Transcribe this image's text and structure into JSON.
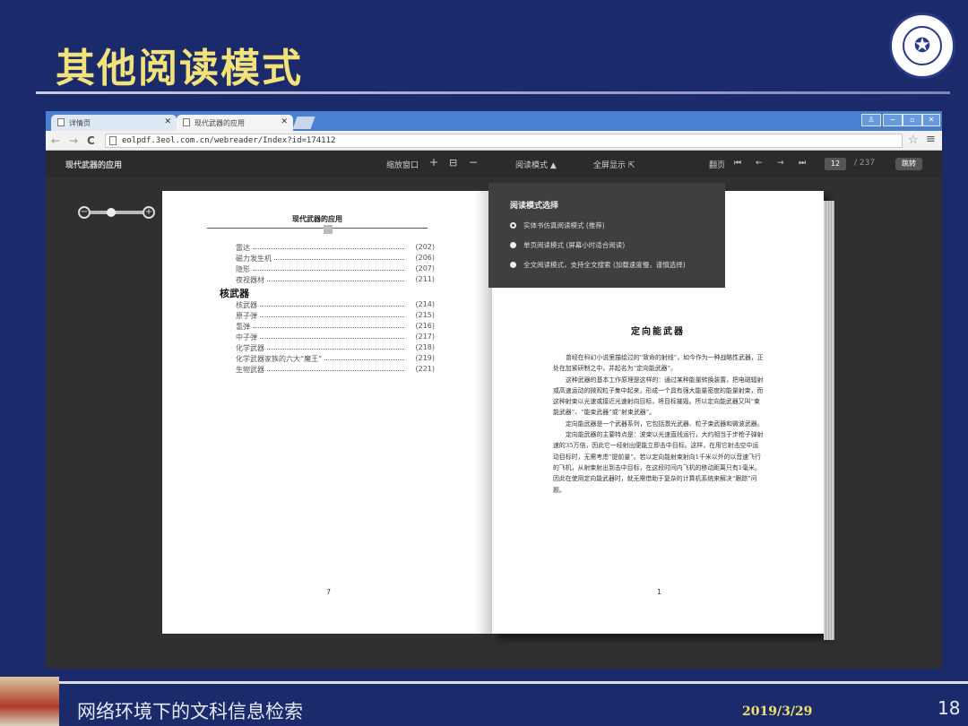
{
  "slide": {
    "title": "其他阅读模式",
    "footer_text": "网络环境下的文科信息检索",
    "date": "2019/3/29",
    "page_number": "18"
  },
  "browser": {
    "tabs": [
      {
        "label": "详情页",
        "active": false
      },
      {
        "label": "现代武器的应用",
        "active": true
      }
    ],
    "url": "eolpdf.3eol.com.cn/webreader/Index?id=174112",
    "nav": {
      "back": "←",
      "forward": "→",
      "reload": "C"
    }
  },
  "reader_toolbar": {
    "book_title": "现代武器的应用",
    "shrink_window": "缩放窗口",
    "zoom_in": "+",
    "fit": "⊟",
    "zoom_out": "−",
    "reading_mode": "阅读模式 ▲",
    "fullscreen": "全屏显示 ⇱",
    "flip": "翻页",
    "current_page": "12",
    "total_pages": "/ 237",
    "go": "跳转"
  },
  "mode_panel": {
    "title": "阅读模式选择",
    "options": [
      {
        "label": "实体书仿真阅读模式 (推荐)",
        "selected": true
      },
      {
        "label": "单页阅读模式 (屏幕小时适合阅读)",
        "selected": false
      },
      {
        "label": "全文阅读模式，支持全文搜索 (加载速度慢，谨慎选择)",
        "selected": false
      }
    ]
  },
  "left_page": {
    "header": "现代武器的应用",
    "toc_pre": [
      {
        "title": "雷达",
        "page": "(202)"
      },
      {
        "title": "磁力发生机",
        "page": "(206)"
      },
      {
        "title": "隐形",
        "page": "(207)"
      },
      {
        "title": "夜视器材",
        "page": "(211)"
      }
    ],
    "section": "核武器",
    "toc_nuke": [
      {
        "title": "核武器",
        "page": "(214)"
      },
      {
        "title": "原子弹",
        "page": "(215)"
      },
      {
        "title": "氢弹",
        "page": "(216)"
      },
      {
        "title": "中子弹",
        "page": "(217)"
      },
      {
        "title": "化学武器",
        "page": "(218)"
      },
      {
        "title": "化学武器家族的六大“魔王”",
        "page": "(219)"
      },
      {
        "title": "生物武器",
        "page": "(221)"
      }
    ],
    "page_num": "7"
  },
  "right_page": {
    "title": "定向能武器",
    "paragraphs": [
      "曾经在科幻小说里描绘过的“致命的射线”，如今作为一种战略性武器，正处在加紧研制之中，并起名为“定向能武器”。",
      "这种武器的基本工作原理是这样的：通过某种能量转换装置，把电磁辐射或高速运动的微观粒子集中起来，形成一个具有强大能量密度的能量射束，而这种射束以光速或接近光速射向目标，将目标摧毁。所以定向能武器又叫“束能武器”、“能束武器”或“射束武器”。",
      "定向能武器是一个武器系列，它包括激光武器、粒子束武器和微波武器。",
      "定向能武器的主要特点是：波束以光速直线运行，大约相当于步枪子弹射速的35万倍，因此它一经射出便能立即击中目标。这样，在用它射击空中运动目标时，无需考虑“提前量”。若以定向能射束射向1千米以外的以音速飞行的飞机，从射束射出到击中目标，在这段时间内飞机的移动距离只有1毫米。因此在使用定向能武器时，就无需借助于复杂的计算机系统来解决“跟踪”问题。"
    ],
    "page_num": "1"
  }
}
